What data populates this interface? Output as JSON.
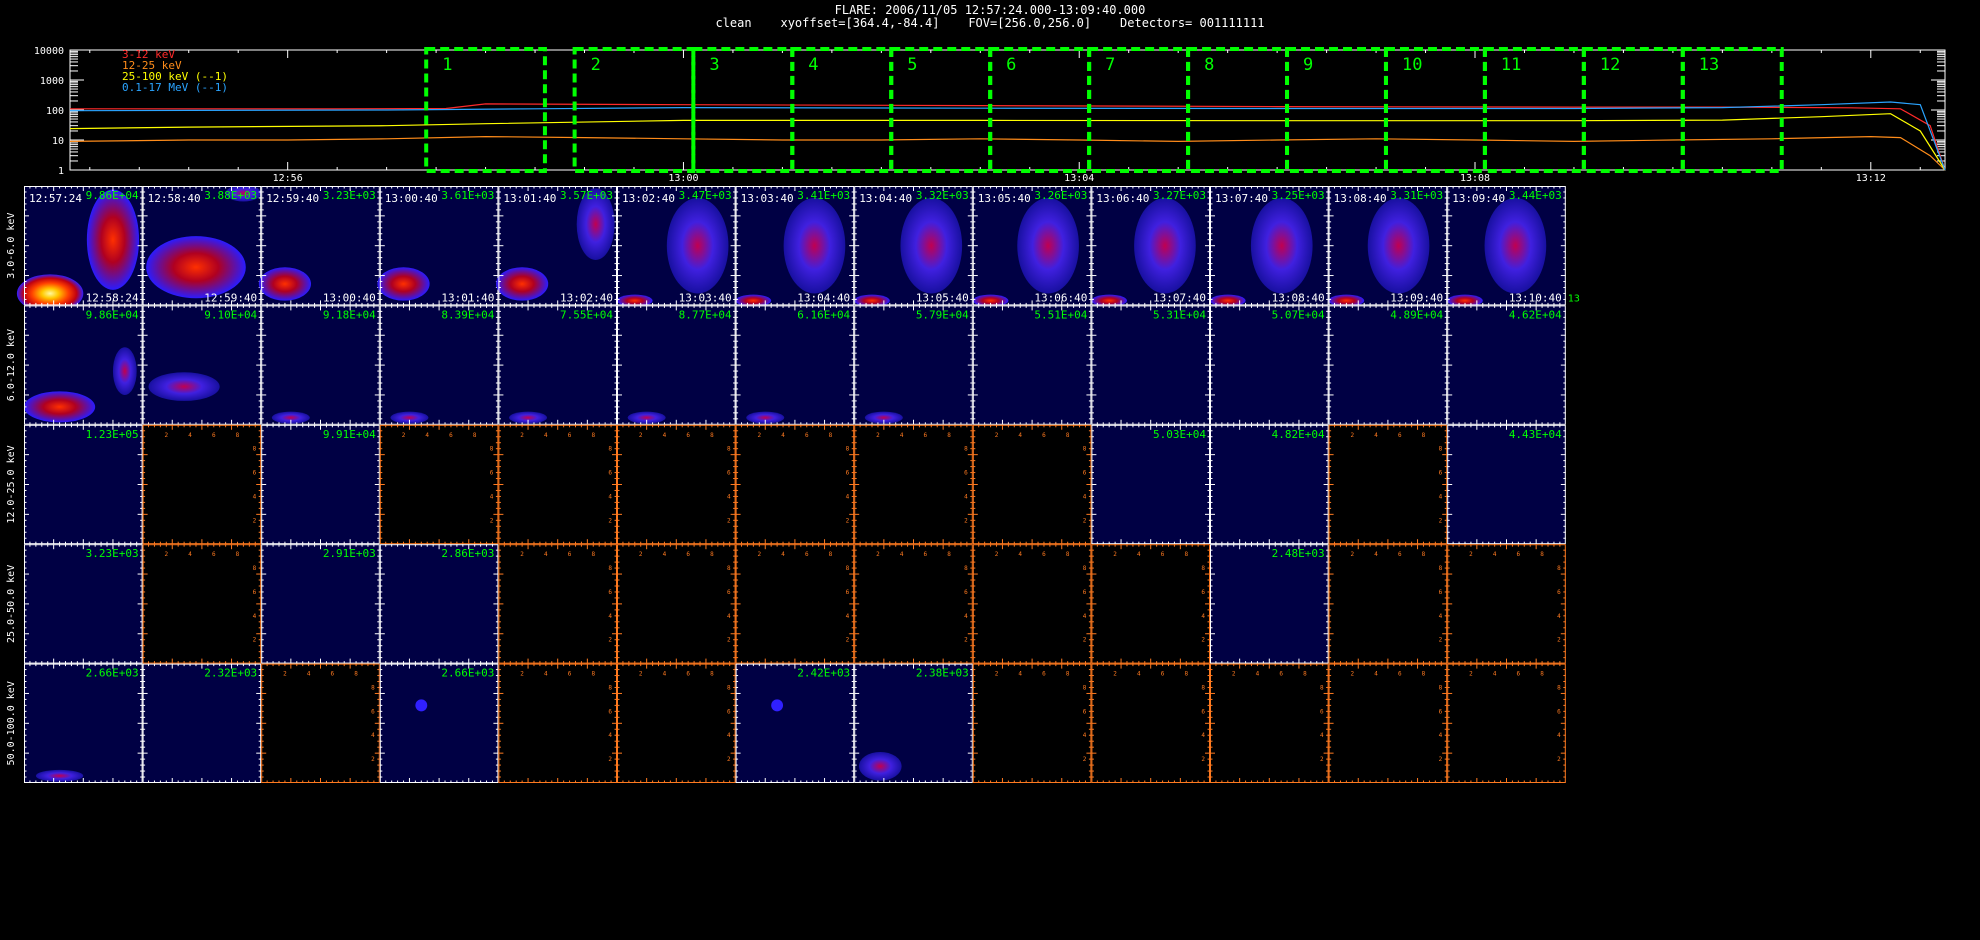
{
  "header": {
    "line1": "FLARE: 2006/11/05 12:57:24.000-13:09:40.000",
    "line2": "clean    xyoffset=[364.4,-84.4]    FOV=[256.0,256.0]    Detectors= 001111111"
  },
  "colors": {
    "band_3_12": "#ff2a2a",
    "band_12_25": "#ff8c1a",
    "band_25_100": "#ffff00",
    "band_01_17": "#2aa4ff",
    "interval_box": "#00ff00",
    "panel_value": "#00ff00",
    "blank_axis": "#ff7a20",
    "panel_bg": "#000044"
  },
  "chart_data": [
    {
      "type": "line",
      "title": "",
      "ylim": [
        1,
        10000
      ],
      "yscale": "log",
      "ytick_labels": [
        "10000",
        "1000",
        "100",
        "10",
        "1"
      ],
      "xtick_labels": [
        "12:56",
        "13:00",
        "13:04",
        "13:08",
        "13:12"
      ],
      "xtick_values": [
        56,
        60,
        64,
        68,
        72
      ],
      "xlim": [
        53.8,
        72.75
      ],
      "legend_position": "top-left",
      "series": [
        {
          "name": "3-12 keV",
          "color_key": "band_3_12",
          "x": [
            53.8,
            55.0,
            56.5,
            57.6,
            58.0,
            60.0,
            63.0,
            66.0,
            69.0,
            70.5,
            71.8,
            72.3,
            72.6,
            72.75
          ],
          "y": [
            110,
            110,
            110,
            112,
            160,
            150,
            140,
            130,
            125,
            125,
            118,
            110,
            30,
            1
          ]
        },
        {
          "name": "12-25 keV",
          "color_key": "band_12_25",
          "x": [
            53.8,
            55.0,
            56.0,
            57.0,
            58.0,
            59.0,
            60.0,
            61.0,
            62.0,
            63.0,
            64.0,
            65.0,
            66.0,
            67.0,
            68.0,
            69.0,
            70.0,
            71.0,
            72.0,
            72.3,
            72.6,
            72.75
          ],
          "y": [
            9,
            10,
            10,
            11,
            13,
            12,
            11,
            10,
            10,
            11,
            10,
            9,
            10,
            11,
            10,
            9,
            10,
            11,
            13,
            12,
            3,
            1
          ]
        },
        {
          "name": "25-100 keV (--1)",
          "color_key": "band_25_100",
          "x": [
            53.8,
            55.0,
            57.0,
            58.0,
            60.0,
            63.0,
            66.0,
            69.0,
            70.5,
            71.5,
            72.2,
            72.5,
            72.75
          ],
          "y": [
            24,
            27,
            30,
            35,
            45,
            45,
            44,
            44,
            46,
            60,
            75,
            20,
            1
          ]
        },
        {
          "name": "0.1-17 MeV (--1)",
          "color_key": "band_01_17",
          "x": [
            53.8,
            55.0,
            57.0,
            58.5,
            60.0,
            63.0,
            66.0,
            69.0,
            70.5,
            71.5,
            72.2,
            72.5,
            72.75
          ],
          "y": [
            95,
            97,
            100,
            110,
            120,
            115,
            112,
            112,
            120,
            150,
            185,
            150,
            1
          ]
        }
      ],
      "intervals": [
        {
          "label": "1",
          "start": 57.4,
          "end": 58.6
        },
        {
          "label": "2",
          "start": 58.9,
          "end": 60.1
        },
        {
          "label": "3",
          "start": 60.1,
          "end": 61.1
        },
        {
          "label": "4",
          "start": 61.1,
          "end": 62.1
        },
        {
          "label": "5",
          "start": 62.1,
          "end": 63.1
        },
        {
          "label": "6",
          "start": 63.1,
          "end": 64.1
        },
        {
          "label": "7",
          "start": 64.1,
          "end": 65.1
        },
        {
          "label": "8",
          "start": 65.1,
          "end": 66.1
        },
        {
          "label": "9",
          "start": 66.1,
          "end": 67.1
        },
        {
          "label": "10",
          "start": 67.1,
          "end": 68.1
        },
        {
          "label": "11",
          "start": 68.1,
          "end": 69.1
        },
        {
          "label": "12",
          "start": 69.1,
          "end": 70.1
        },
        {
          "label": "13",
          "start": 70.1,
          "end": 71.1
        }
      ]
    },
    {
      "type": "heatmap",
      "title": "",
      "energy_bands": [
        "3.0-6.0 keV",
        "6.0-12.0 keV",
        "12.0-25.0 keV",
        "25.0-50.0 keV",
        "50.0-100.0 keV"
      ],
      "panel_axis_ticks": [
        "2",
        "4",
        "6",
        "8"
      ],
      "start_times": [
        "12:57:24",
        "12:58:40",
        "12:59:40",
        "13:00:40",
        "13:01:40",
        "13:02:40",
        "13:03:40",
        "13:04:40",
        "13:05:40",
        "13:06:40",
        "13:07:40",
        "13:08:40",
        "13:09:40"
      ],
      "end_times": [
        "12:58:24",
        "12:59:40",
        "13:00:40",
        "13:01:40",
        "13:02:40",
        "13:03:40",
        "13:04:40",
        "13:05:40",
        "13:06:40",
        "13:07:40",
        "13:08:40",
        "13:09:40",
        "13:10:40"
      ],
      "interval_numbers": [
        "1",
        "2",
        "3",
        "4",
        "5",
        "6",
        "7",
        "8",
        "9",
        "10",
        "11",
        "12",
        "13"
      ],
      "peak_values": [
        [
          "9.86E+04",
          "3.88E+03",
          "3.23E+03",
          "3.61E+03",
          "3.57E+03",
          "3.47E+03",
          "3.41E+03",
          "3.32E+03",
          "3.26E+03",
          "3.27E+03",
          "3.25E+03",
          "3.31E+03",
          "3.44E+03"
        ],
        [
          "9.86E+04",
          "9.10E+04",
          "9.18E+04",
          "8.39E+04",
          "7.55E+04",
          "8.77E+04",
          "6.16E+04",
          "5.79E+04",
          "5.51E+04",
          "5.31E+04",
          "5.07E+04",
          "4.89E+04",
          "4.62E+04"
        ],
        [
          "1.23E+05",
          "",
          "9.91E+04",
          "",
          "",
          "",
          "",
          "",
          "",
          "5.03E+04",
          "4.82E+04",
          "",
          "4.43E+04"
        ],
        [
          "3.23E+03",
          "",
          "2.91E+03",
          "2.86E+03",
          "",
          "",
          "",
          "",
          "",
          "",
          "2.48E+03",
          "",
          ""
        ],
        [
          "2.66E+03",
          "2.32E+03",
          "",
          "2.66E+03",
          "",
          "",
          "2.42E+03",
          "2.38E+03",
          "",
          "",
          "",
          "",
          ""
        ]
      ],
      "panel_status": [
        [
          1,
          1,
          1,
          1,
          1,
          1,
          1,
          1,
          1,
          1,
          1,
          1,
          1
        ],
        [
          1,
          1,
          1,
          1,
          1,
          1,
          1,
          1,
          1,
          1,
          1,
          1,
          1
        ],
        [
          1,
          0,
          1,
          0,
          0,
          0,
          0,
          0,
          0,
          1,
          1,
          0,
          1
        ],
        [
          1,
          0,
          1,
          1,
          0,
          0,
          0,
          0,
          0,
          0,
          1,
          0,
          0
        ],
        [
          1,
          1,
          0,
          1,
          0,
          0,
          1,
          1,
          0,
          0,
          0,
          0,
          0
        ]
      ]
    }
  ]
}
